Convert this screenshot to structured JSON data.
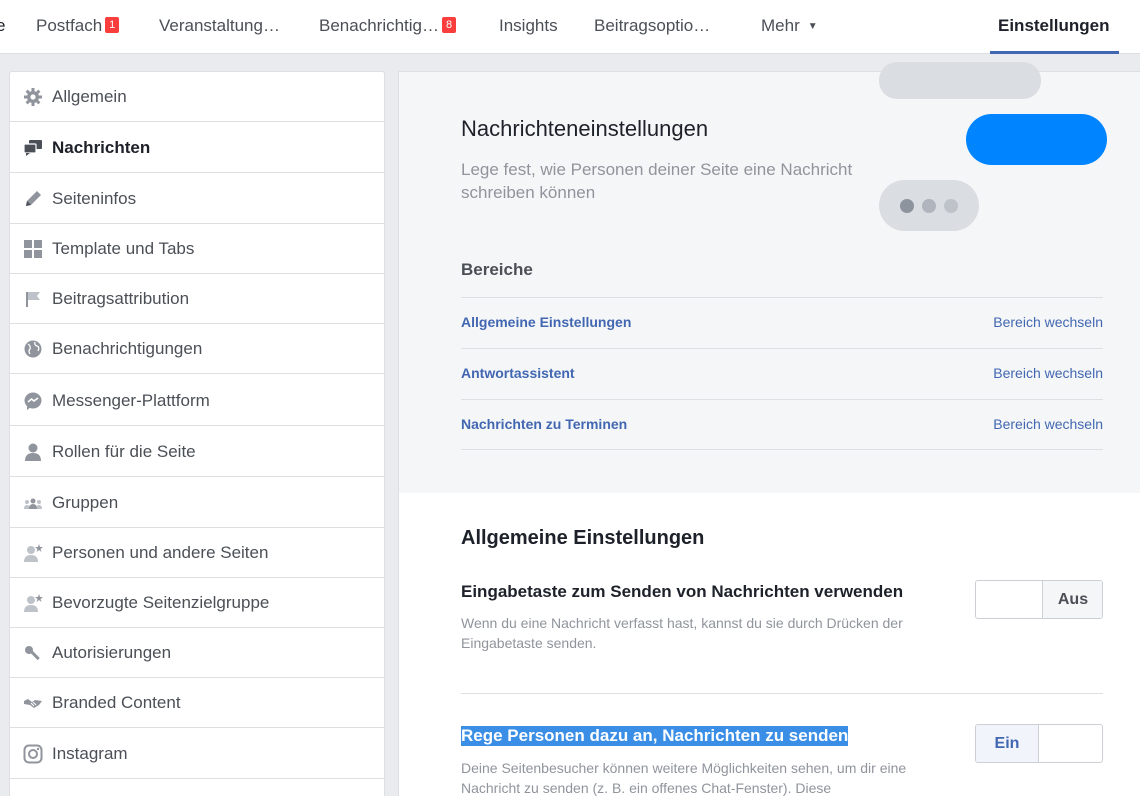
{
  "topnav": {
    "edge_char": "e",
    "items": [
      {
        "label": "Postfach",
        "badge": "1"
      },
      {
        "label": "Veranstaltung…"
      },
      {
        "label": "Benachrichtig…",
        "badge": "8"
      },
      {
        "label": "Insights"
      },
      {
        "label": "Beitragsoptio…"
      },
      {
        "label": "Mehr"
      }
    ],
    "active": "Einstellungen"
  },
  "sidebar": {
    "items": [
      {
        "label": "Allgemein",
        "icon": "gear-icon"
      },
      {
        "label": "Nachrichten",
        "icon": "messages-icon",
        "active": true
      },
      {
        "label": "Seiteninfos",
        "icon": "pencil-icon"
      },
      {
        "label": "Template und Tabs",
        "icon": "grid-icon"
      },
      {
        "label": "Beitragsattribution",
        "icon": "flag-icon"
      },
      {
        "label": "Benachrichtigungen",
        "icon": "globe-icon"
      },
      {
        "label": "Messenger-Plattform",
        "icon": "messenger-icon"
      },
      {
        "label": "Rollen für die Seite",
        "icon": "person-icon"
      },
      {
        "label": "Gruppen",
        "icon": "group-icon"
      },
      {
        "label": "Personen und andere Seiten",
        "icon": "person-star-icon"
      },
      {
        "label": "Bevorzugte Seitenzielgruppe",
        "icon": "person-star-icon"
      },
      {
        "label": "Autorisierungen",
        "icon": "key-icon"
      },
      {
        "label": "Branded Content",
        "icon": "handshake-icon"
      },
      {
        "label": "Instagram",
        "icon": "instagram-icon"
      }
    ]
  },
  "hero": {
    "title": "Nachrichteneinstellungen",
    "subtitle": "Lege fest, wie Personen deiner Seite eine Nachricht schreiben können"
  },
  "areas": {
    "title": "Bereiche",
    "action_label": "Bereich wechseln",
    "rows": [
      {
        "name": "Allgemeine Einstellungen"
      },
      {
        "name": "Antwortassistent"
      },
      {
        "name": "Nachrichten zu Terminen"
      }
    ]
  },
  "general": {
    "title": "Allgemeine Einstellungen",
    "settings": [
      {
        "title": "Eingabetaste zum Senden von Nachrichten verwenden",
        "desc": "Wenn du eine Nachricht verfasst hast, kannst du sie durch Drücken der Eingabetaste senden.",
        "toggle": "Aus"
      },
      {
        "title": "Rege Personen dazu an, Nachrichten zu senden",
        "desc": "Deine Seitenbesucher können weitere Möglichkeiten sehen, um dir eine Nachricht zu senden (z. B. ein offenes Chat-Fenster). Diese",
        "toggle": "Ein"
      }
    ]
  },
  "colors": {
    "accent": "#4267b2",
    "messenger_blue": "#0084ff",
    "badge_red": "#fa3e3e"
  }
}
